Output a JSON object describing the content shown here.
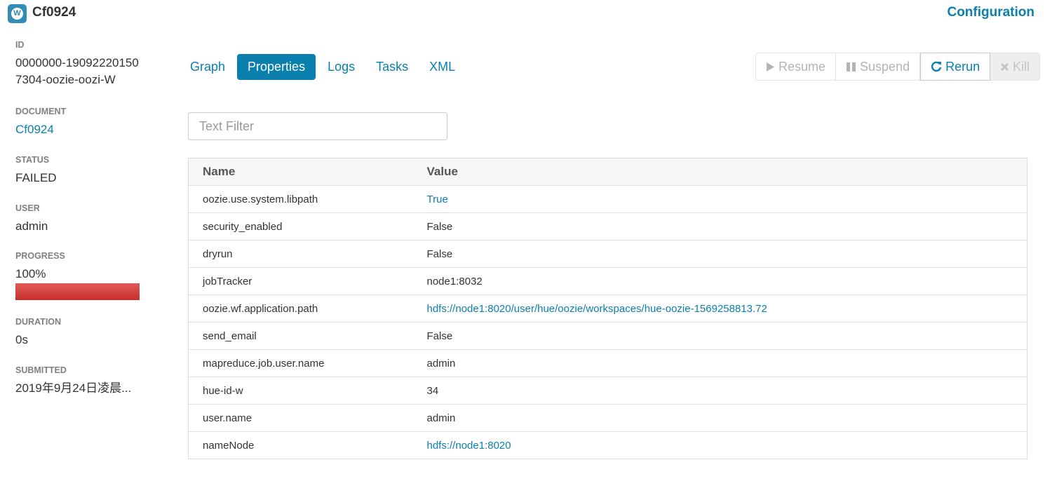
{
  "header": {
    "app_icon_letter": "W",
    "title": "Cf0924",
    "config_link": "Configuration"
  },
  "sidebar": {
    "id_label": "ID",
    "id_value": "0000000-190922201507304-oozie-oozi-W",
    "document_label": "DOCUMENT",
    "document_value": "Cf0924",
    "status_label": "STATUS",
    "status_value": "FAILED",
    "user_label": "USER",
    "user_value": "admin",
    "progress_label": "PROGRESS",
    "progress_value": "100%",
    "progress_fraction": 1.0,
    "progress_color": "#d9534f",
    "duration_label": "DURATION",
    "duration_value": "0s",
    "submitted_label": "SUBMITTED",
    "submitted_value": "2019年9月24日凌晨..."
  },
  "tabs": [
    {
      "label": "Graph",
      "active": false
    },
    {
      "label": "Properties",
      "active": true
    },
    {
      "label": "Logs",
      "active": false
    },
    {
      "label": "Tasks",
      "active": false
    },
    {
      "label": "XML",
      "active": false
    }
  ],
  "actions": {
    "resume": "Resume",
    "suspend": "Suspend",
    "rerun": "Rerun",
    "kill": "Kill"
  },
  "filter": {
    "placeholder": "Text Filter",
    "value": ""
  },
  "table": {
    "headers": [
      "Name",
      "Value"
    ],
    "rows": [
      {
        "name": "oozie.use.system.libpath",
        "value": "True",
        "link": true
      },
      {
        "name": "security_enabled",
        "value": "False",
        "link": false
      },
      {
        "name": "dryrun",
        "value": "False",
        "link": false
      },
      {
        "name": "jobTracker",
        "value": "node1:8032",
        "link": false
      },
      {
        "name": "oozie.wf.application.path",
        "value": "hdfs://node1:8020/user/hue/oozie/workspaces/hue-oozie-1569258813.72",
        "link": true
      },
      {
        "name": "send_email",
        "value": "False",
        "link": false
      },
      {
        "name": "mapreduce.job.user.name",
        "value": "admin",
        "link": false
      },
      {
        "name": "hue-id-w",
        "value": "34",
        "link": false
      },
      {
        "name": "user.name",
        "value": "admin",
        "link": false
      },
      {
        "name": "nameNode",
        "value": "hdfs://node1:8020",
        "link": true
      }
    ]
  },
  "colors": {
    "accent": "#0b7fad",
    "progress_failed": "#d9534f"
  },
  "icons": {
    "app": "workflow-app-icon",
    "resume": "play-icon",
    "suspend": "pause-icon",
    "rerun": "refresh-icon",
    "kill": "close-icon"
  }
}
